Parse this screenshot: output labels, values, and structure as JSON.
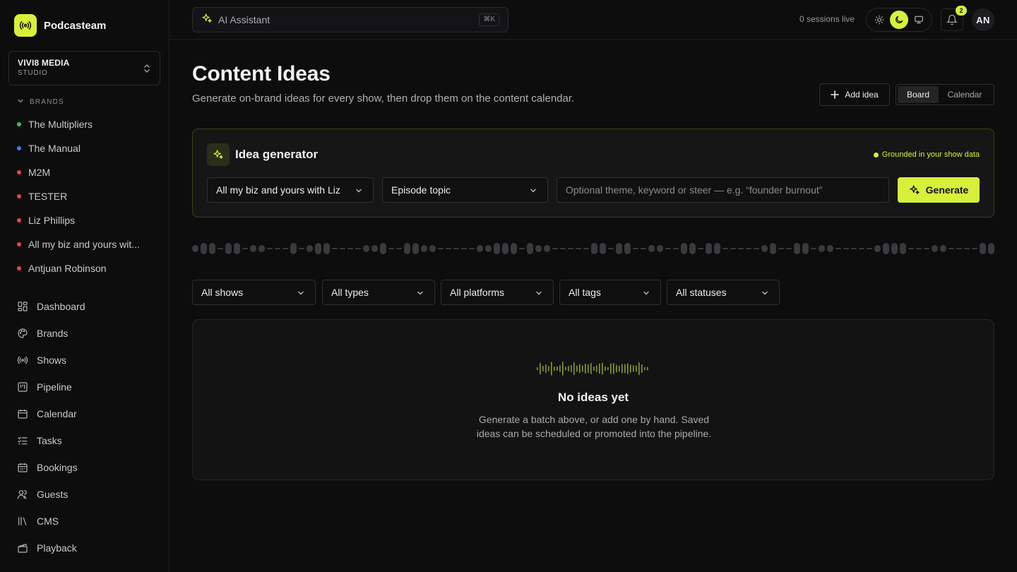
{
  "app": {
    "name": "Podcasteam"
  },
  "workspace": {
    "name": "VIVI8 MEDIA",
    "type": "STUDIO"
  },
  "sidebar": {
    "brands_heading": "BRANDS",
    "brands": [
      {
        "label": "The Multipliers",
        "color": "#35c46a"
      },
      {
        "label": "The Manual",
        "color": "#3b82f6"
      },
      {
        "label": "M2M",
        "color": "#ef4444"
      },
      {
        "label": "TESTER",
        "color": "#ef4444"
      },
      {
        "label": "Liz Phillips",
        "color": "#ef4444"
      },
      {
        "label": "All my biz and yours wit...",
        "color": "#ef4444"
      },
      {
        "label": "Antjuan Robinson",
        "color": "#ef4444"
      }
    ],
    "nav": [
      {
        "label": "Dashboard",
        "icon": "dashboard-icon"
      },
      {
        "label": "Brands",
        "icon": "palette-icon"
      },
      {
        "label": "Shows",
        "icon": "radio-icon"
      },
      {
        "label": "Pipeline",
        "icon": "kanban-icon"
      },
      {
        "label": "Calendar",
        "icon": "calendar-icon"
      },
      {
        "label": "Tasks",
        "icon": "checklist-icon"
      },
      {
        "label": "Bookings",
        "icon": "calendar-check-icon"
      },
      {
        "label": "Guests",
        "icon": "users-icon"
      },
      {
        "label": "CMS",
        "icon": "library-icon"
      },
      {
        "label": "Playback",
        "icon": "clapper-icon"
      }
    ]
  },
  "topbar": {
    "assistant_label": "AI Assistant",
    "shortcut": "⌘K",
    "sessions": "0 sessions live",
    "active_theme": "dark",
    "notifications_count": "2",
    "avatar_initials": "AN"
  },
  "page": {
    "title": "Content Ideas",
    "subtitle": "Generate on-brand ideas for every show, then drop them on the content calendar.",
    "add_idea_label": "Add idea",
    "views": [
      "Board",
      "Calendar"
    ],
    "active_view": "Board"
  },
  "generator": {
    "title": "Idea generator",
    "grounded_label": "Grounded in your show data",
    "show_select": "All my biz and yours with Liz",
    "type_select": "Episode topic",
    "theme_placeholder": "Optional theme, keyword or steer — e.g. “founder burnout”",
    "theme_value": "",
    "generate_label": "Generate"
  },
  "filters": [
    {
      "label": "All shows"
    },
    {
      "label": "All types"
    },
    {
      "label": "All platforms"
    },
    {
      "label": "All tags"
    },
    {
      "label": "All statuses"
    }
  ],
  "empty_state": {
    "title": "No ideas yet",
    "description": "Generate a batch above, or add one by hand. Saved ideas can be scheduled or promoted into the pipeline."
  },
  "colors": {
    "accent": "#d8f03a",
    "background": "#0d0d0e",
    "panel": "#161617",
    "border": "#2f2f33"
  }
}
